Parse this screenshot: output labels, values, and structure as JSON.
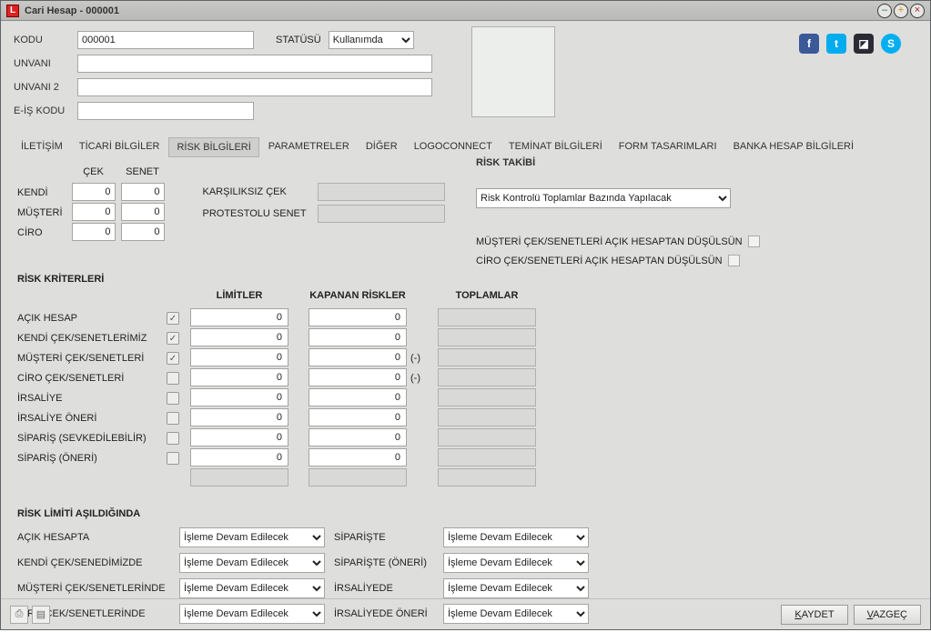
{
  "window": {
    "title": "Cari Hesap - 000001"
  },
  "header": {
    "kodu_label": "KODU",
    "kodu_value": "000001",
    "status_label": "STATÜSÜ",
    "status_value": "Kullanımda",
    "unvani_label": "UNVANI",
    "unvani_value": "",
    "unvani2_label": "UNVANI 2",
    "unvani2_value": "",
    "eis_label": "E-İŞ KODU",
    "eis_value": ""
  },
  "social": {
    "fb": "f",
    "tw": "t",
    "pic": "◪",
    "sk": "S"
  },
  "tabs": {
    "iletisim": "İLETİŞİM",
    "ticari": "TİCARİ BİLGİLER",
    "risk": "RİSK BİLGİLERİ",
    "param": "PARAMETRELER",
    "diger": "DİĞER",
    "logo": "LOGOCONNECT",
    "teminat": "TEMİNAT BİLGİLERİ",
    "form": "FORM TASARIMLARI",
    "banka": "BANKA HESAP BİLGİLERİ"
  },
  "cs": {
    "cek": "ÇEK",
    "senet": "SENET",
    "rows": {
      "kendi": "KENDİ",
      "musteri": "MÜŞTERİ",
      "ciro": "CİRO"
    },
    "vals": {
      "kendi_cek": "0",
      "kendi_senet": "0",
      "musteri_cek": "0",
      "musteri_senet": "0",
      "ciro_cek": "0",
      "ciro_senet": "0"
    },
    "ks_cek": "KARŞILIKSIZ ÇEK",
    "pr_senet": "PROTESTOLU SENET"
  },
  "rt": {
    "title": "RİSK TAKİBİ",
    "select": "Risk Kontrolü Toplamlar Bazında Yapılacak",
    "chk1": "MÜŞTERİ ÇEK/SENETLERİ AÇIK HESAPTAN DÜŞÜLSÜN",
    "chk2": "CİRO ÇEK/SENETLERİ AÇIK HESAPTAN DÜŞÜLSÜN"
  },
  "rk": {
    "title": "RİSK KRİTERLERİ",
    "col_limit": "LİMİTLER",
    "col_kapanan": "KAPANAN RİSKLER",
    "col_toplam": "TOPLAMLAR",
    "minus": "(-)",
    "rows": {
      "r1": "AÇIK HESAP",
      "r2": "KENDİ ÇEK/SENETLERİMİZ",
      "r3": "MÜŞTERİ ÇEK/SENETLERİ",
      "r4": "CİRO ÇEK/SENETLERİ",
      "r5": "İRSALİYE",
      "r6": "İRSALİYE ÖNERİ",
      "r7": "SİPARİŞ (SEVKEDİLEBİLİR)",
      "r8": "SİPARİŞ (ÖNERİ)"
    },
    "v": {
      "l1": "0",
      "l2": "0",
      "l3": "0",
      "l4": "0",
      "l5": "0",
      "l6": "0",
      "l7": "0",
      "l8": "0",
      "k1": "0",
      "k2": "0",
      "k3": "0",
      "k4": "0",
      "k5": "0",
      "k6": "0",
      "k7": "0",
      "k8": "0"
    }
  },
  "rl": {
    "title": "RİSK LİMİTİ AŞILDIĞINDA",
    "left": {
      "r1": "AÇIK HESAPTA",
      "r2": "KENDİ ÇEK/SENEDİMİZDE",
      "r3": "MÜŞTERİ ÇEK/SENETLERİNDE",
      "r4": "CİRO ÇEK/SENETLERİNDE"
    },
    "right": {
      "r1": "SİPARİŞTE",
      "r2": "SİPARİŞTE (ÖNERİ)",
      "r3": "İRSALİYEDE",
      "r4": "İRSALİYEDE ÖNERİ"
    },
    "opt": "İşleme Devam Edilecek"
  },
  "footer": {
    "print": "⎙",
    "doc": "▤",
    "save_u": "K",
    "save_r": "AYDET",
    "cancel_u": "V",
    "cancel_r": "AZGEÇ"
  }
}
